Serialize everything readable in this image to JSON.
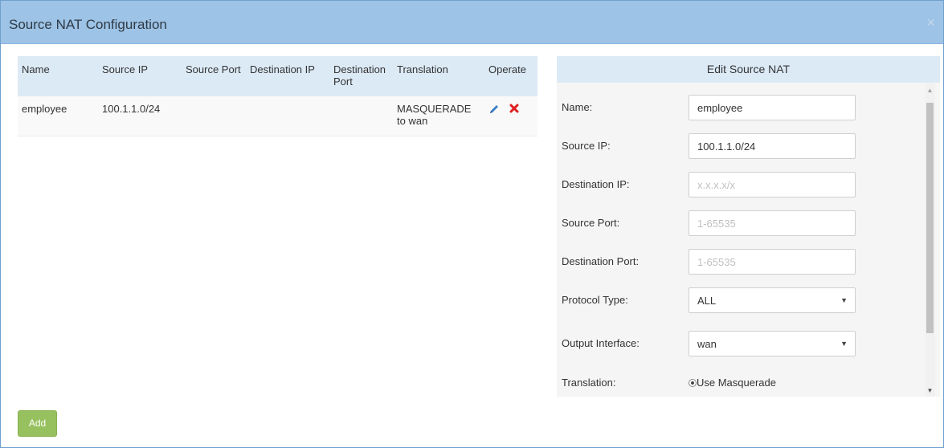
{
  "dialog": {
    "title": "Source NAT Configuration",
    "close_label": "×"
  },
  "table": {
    "headers": [
      "Name",
      "Source IP",
      "Source Port",
      "Destination IP",
      "Destination Port",
      "Translation",
      "Operate"
    ],
    "rows": [
      {
        "name": "employee",
        "source_ip": "100.1.1.0/24",
        "source_port": "",
        "destination_ip": "",
        "destination_port": "",
        "translation": "MASQUERADE to wan"
      }
    ]
  },
  "edit_panel": {
    "title": "Edit Source NAT",
    "fields": {
      "name": {
        "label": "Name:",
        "value": "employee",
        "placeholder": ""
      },
      "source_ip": {
        "label": "Source IP:",
        "value": "100.1.1.0/24",
        "placeholder": ""
      },
      "destination_ip": {
        "label": "Destination IP:",
        "value": "",
        "placeholder": "x.x.x.x/x"
      },
      "source_port": {
        "label": "Source Port:",
        "value": "",
        "placeholder": "1-65535"
      },
      "destination_port": {
        "label": "Destination Port:",
        "value": "",
        "placeholder": "1-65535"
      },
      "protocol_type": {
        "label": "Protocol Type:",
        "value": "ALL"
      },
      "output_interface": {
        "label": "Output Interface:",
        "value": "wan"
      },
      "translation": {
        "label": "Translation:",
        "option": "Use Masquerade"
      }
    }
  },
  "add_button": {
    "label": "Add"
  },
  "colors": {
    "header_bg": "#9dc3e6",
    "table_header_bg": "#dceaf6",
    "add_button_bg": "#97c15f",
    "edit_icon": "#3a7fc4",
    "delete_icon": "#e02020"
  },
  "icons": {
    "close": "close-icon",
    "edit": "pencil-icon",
    "delete": "x-icon",
    "dropdown": "caret-down-icon"
  }
}
